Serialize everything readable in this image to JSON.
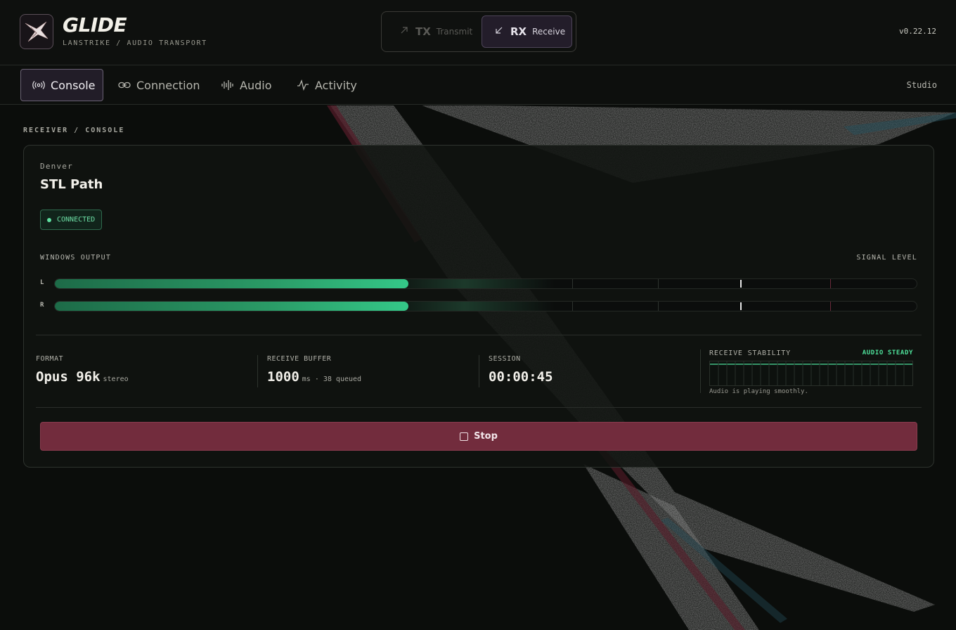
{
  "app": {
    "name": "GLIDE",
    "subtitle": "LANSTRIKE / AUDIO TRANSPORT",
    "version": "v0.22.12"
  },
  "mode_switch": {
    "tx": {
      "code": "TX",
      "label": "Transmit",
      "icon": "arrow-up-right-icon",
      "active": false
    },
    "rx": {
      "code": "RX",
      "label": "Receive",
      "icon": "arrow-down-left-icon",
      "active": true
    }
  },
  "nav": {
    "items": [
      {
        "label": "Console",
        "icon": "broadcast-icon",
        "active": true
      },
      {
        "label": "Connection",
        "icon": "link-icon",
        "active": false
      },
      {
        "label": "Audio",
        "icon": "waveform-icon",
        "active": false
      },
      {
        "label": "Activity",
        "icon": "pulse-icon",
        "active": false
      }
    ],
    "workspace": "Studio"
  },
  "breadcrumb": "RECEIVER / CONSOLE",
  "station": {
    "location": "Denver",
    "name": "STL Path",
    "status": "CONNECTED",
    "status_color": "#5fe0a0"
  },
  "meters": {
    "title": "WINDOWS OUTPUT",
    "right_label": "SIGNAL LEVEL",
    "channels": [
      {
        "label": "L",
        "level": 0.41,
        "peak": 0.795
      },
      {
        "label": "R",
        "level": 0.41,
        "peak": 0.795
      }
    ]
  },
  "stats": {
    "format": {
      "label": "FORMAT",
      "value": "Opus 96k",
      "unit": "stereo"
    },
    "buffer": {
      "label": "RECEIVE BUFFER",
      "value": "1000",
      "unit": "ms · 38 queued"
    },
    "session": {
      "label": "SESSION",
      "value": "00:00:45"
    }
  },
  "stability": {
    "label": "RECEIVE STABILITY",
    "status": "AUDIO STEADY",
    "note": "Audio is playing smoothly.",
    "accent": "#4ee09a"
  },
  "actions": {
    "stop_label": "Stop",
    "stop_color": "#722c3d"
  }
}
